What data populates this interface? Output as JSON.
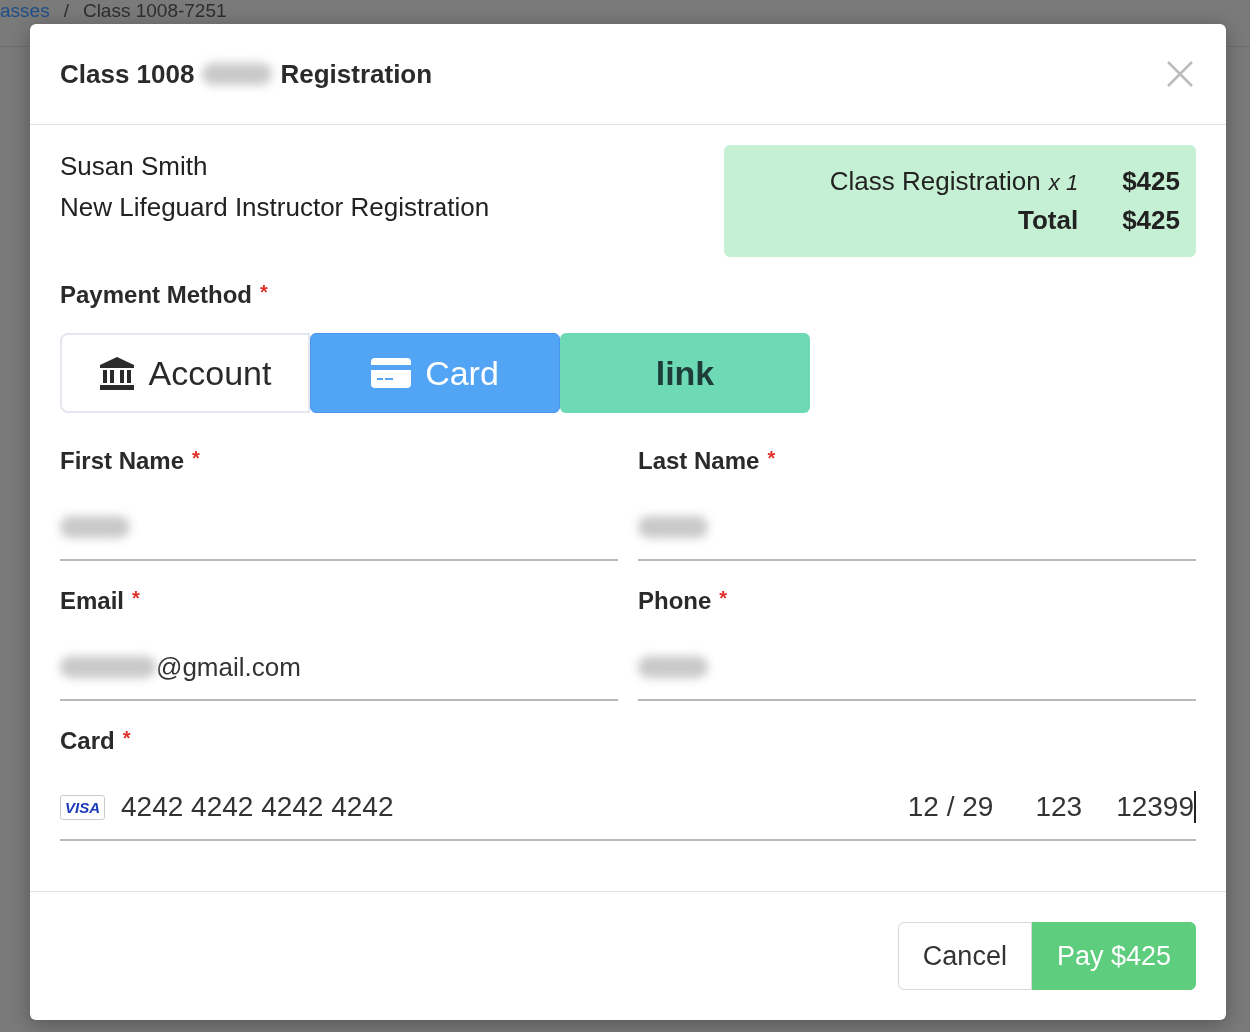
{
  "background": {
    "breadcrumb": [
      "asses",
      "/",
      "Class 1008-7251"
    ]
  },
  "modal": {
    "title_start": "Class 1008",
    "title_end": "Registration",
    "title_redacted": true,
    "customer": {
      "name": "Susan Smith",
      "item": "New Lifeguard Instructor Registration"
    },
    "summary": {
      "line_label": "Class Registration",
      "quantity": "x 1",
      "line_amount": "$425",
      "total_label": "Total",
      "total_amount": "$425"
    },
    "payment_method": {
      "label": "Payment Method",
      "required": "*",
      "options": [
        {
          "kind": "account",
          "label": "Account",
          "selected": false
        },
        {
          "kind": "card",
          "label": "Card",
          "selected": true
        },
        {
          "kind": "link",
          "label": "link",
          "selected": false
        }
      ]
    },
    "fields": [
      {
        "label": "First Name",
        "required": "*",
        "redacted": true
      },
      {
        "label": "Last Name",
        "required": "*",
        "redacted": true
      },
      {
        "label": "Email",
        "required": "*",
        "redacted": true,
        "value": "@gmail.com"
      },
      {
        "label": "Phone",
        "required": "*",
        "redacted": true
      }
    ],
    "card": {
      "label": "Card",
      "required": "*",
      "brand": "VISA",
      "number": "4242 4242 4242 4242",
      "expiry": "12 / 29",
      "cvc": "123",
      "zip": "12399"
    },
    "buttons": {
      "cancel": "Cancel",
      "pay": "Pay $425"
    }
  }
}
